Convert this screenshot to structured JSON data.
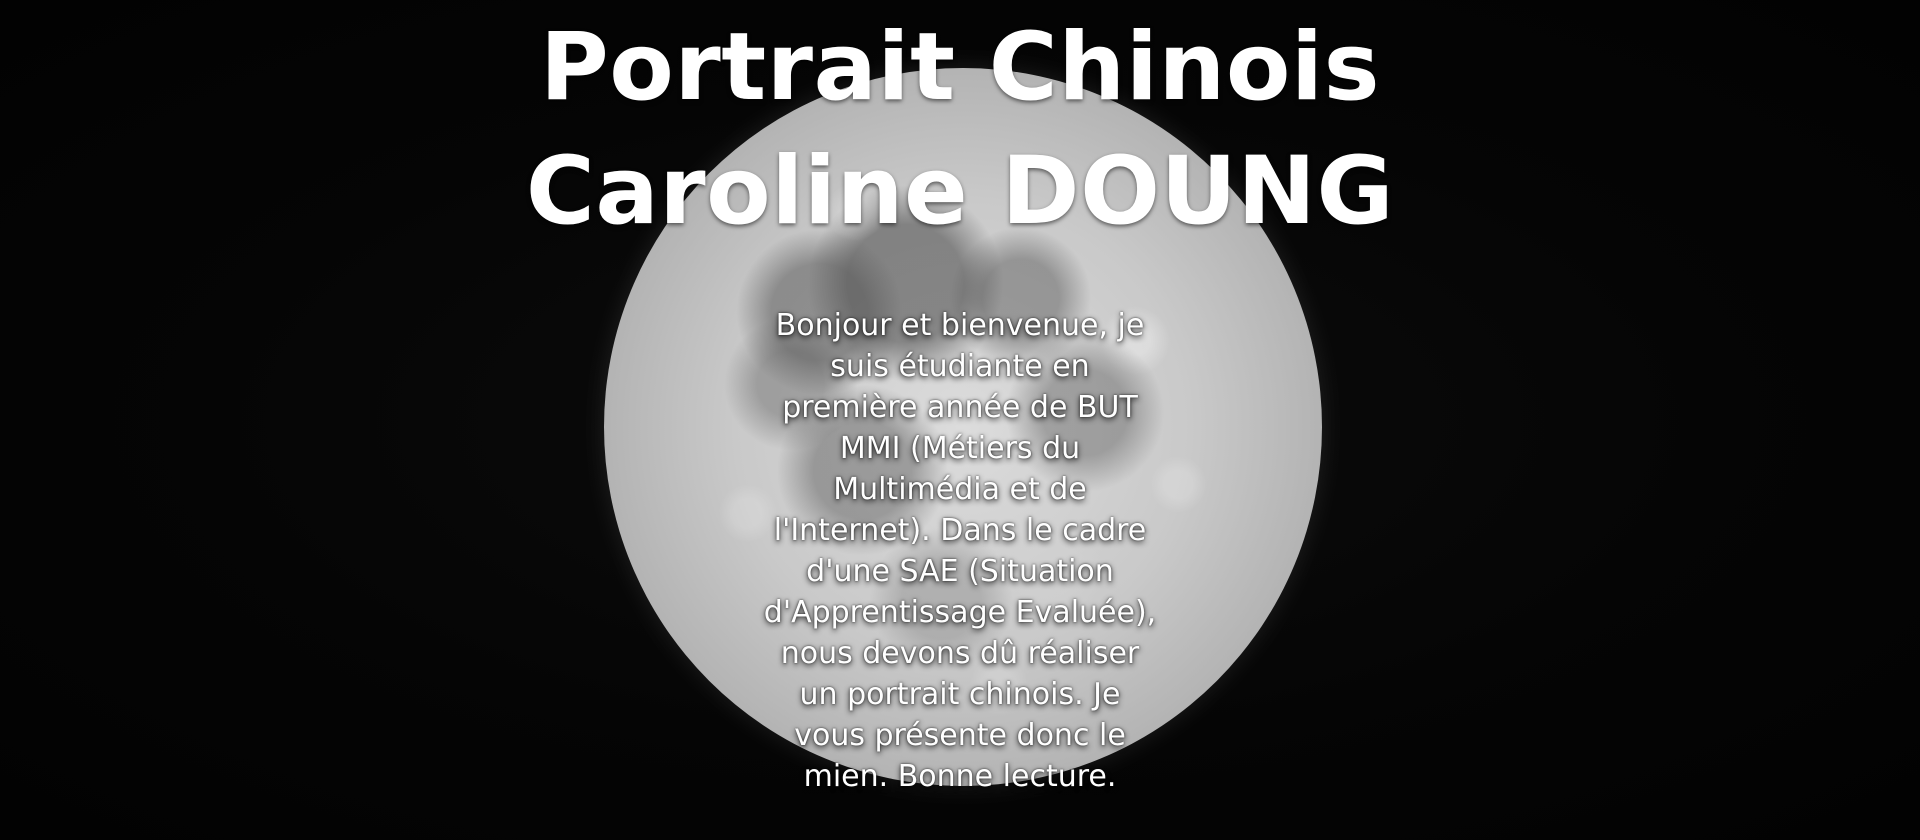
{
  "header": {
    "title_line_1": "Portrait Chinois",
    "title_line_2": "Caroline DOUNG"
  },
  "intro": {
    "lines": [
      "Bonjour et bienvenue, je",
      "suis étudiante en",
      "première année de BUT",
      "MMI (Métiers du",
      "Multimédia et de",
      "l'Internet). Dans le cadre",
      "d'une SAE (Situation",
      "d'Apprentissage Evaluée),",
      "nous devons dû réaliser",
      "un portrait chinois. Je",
      "vous présente donc le",
      "mien. Bonne lecture."
    ]
  },
  "colors": {
    "background": "#030303",
    "text": "#ffffff",
    "moon_base": "#c9c9c9"
  }
}
